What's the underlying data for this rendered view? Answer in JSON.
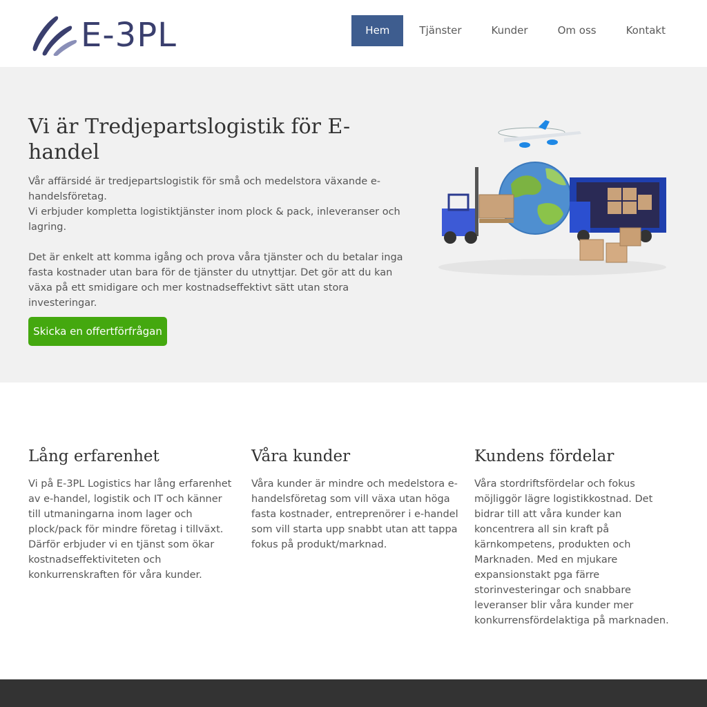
{
  "header": {
    "logo_text": "E-3PL",
    "nav": [
      {
        "label": "Hem",
        "active": true
      },
      {
        "label": "Tjänster",
        "active": false
      },
      {
        "label": "Kunder",
        "active": false
      },
      {
        "label": "Om oss",
        "active": false
      },
      {
        "label": "Kontakt",
        "active": false
      }
    ]
  },
  "hero": {
    "title": "Vi är Tredjepartslogistik för E-handel",
    "para1_line1": "Vår affärsidé är tredjepartslogistik för små och medelstora växande e-handelsföretag.",
    "para1_line2": "Vi erbjuder kompletta logistiktjänster inom plock & pack, inleveranser och lagring.",
    "para2": "Det är enkelt att komma igång och prova våra tjänster och du betalar inga fasta kostnader utan bara för de tjänster du utnyttjar. Det gör att du kan växa på ett smidigare och mer kostnadseffektivt sätt utan stora investeringar.",
    "cta_label": "Skicka en offertförfrågan"
  },
  "features": [
    {
      "title": "Lång erfarenhet",
      "text": "Vi på E-3PL Logistics har lång erfarenhet av e-handel, logistik och IT och känner till utmaningarna inom lager och plock/pack för mindre företag i tillväxt. Därför erbjuder vi en tjänst som ökar kostnadseffektiviteten och konkurrenskraften för våra kunder."
    },
    {
      "title": "Våra kunder",
      "text": "Våra kunder är mindre och medelstora e-handelsföretag som vill växa utan höga fasta kostnader, entreprenörer i e-handel som vill starta upp snabbt utan att tappa fokus på produkt/marknad."
    },
    {
      "title": "Kundens fördelar",
      "text": "Våra stordriftsfördelar och fokus möjliggör lägre logistikkostnad. Det bidrar till att våra kunder kan koncentrera all sin kraft på kärnkompetens, produkten och Marknaden. Med en mjukare expansionstakt pga färre storinvesteringar och snabbare leveranser blir våra kunder mer konkurrensfördelaktiga på marknaden."
    }
  ],
  "colors": {
    "nav_active": "#3e5d8f",
    "cta": "#44a80f",
    "hero_bg": "#f1f1f1",
    "footer_bg": "#333333",
    "logo": "#3a3f6e"
  },
  "icons": {
    "logo_mark": "swoosh-logo-icon",
    "hero_image": "logistics-illustration"
  }
}
